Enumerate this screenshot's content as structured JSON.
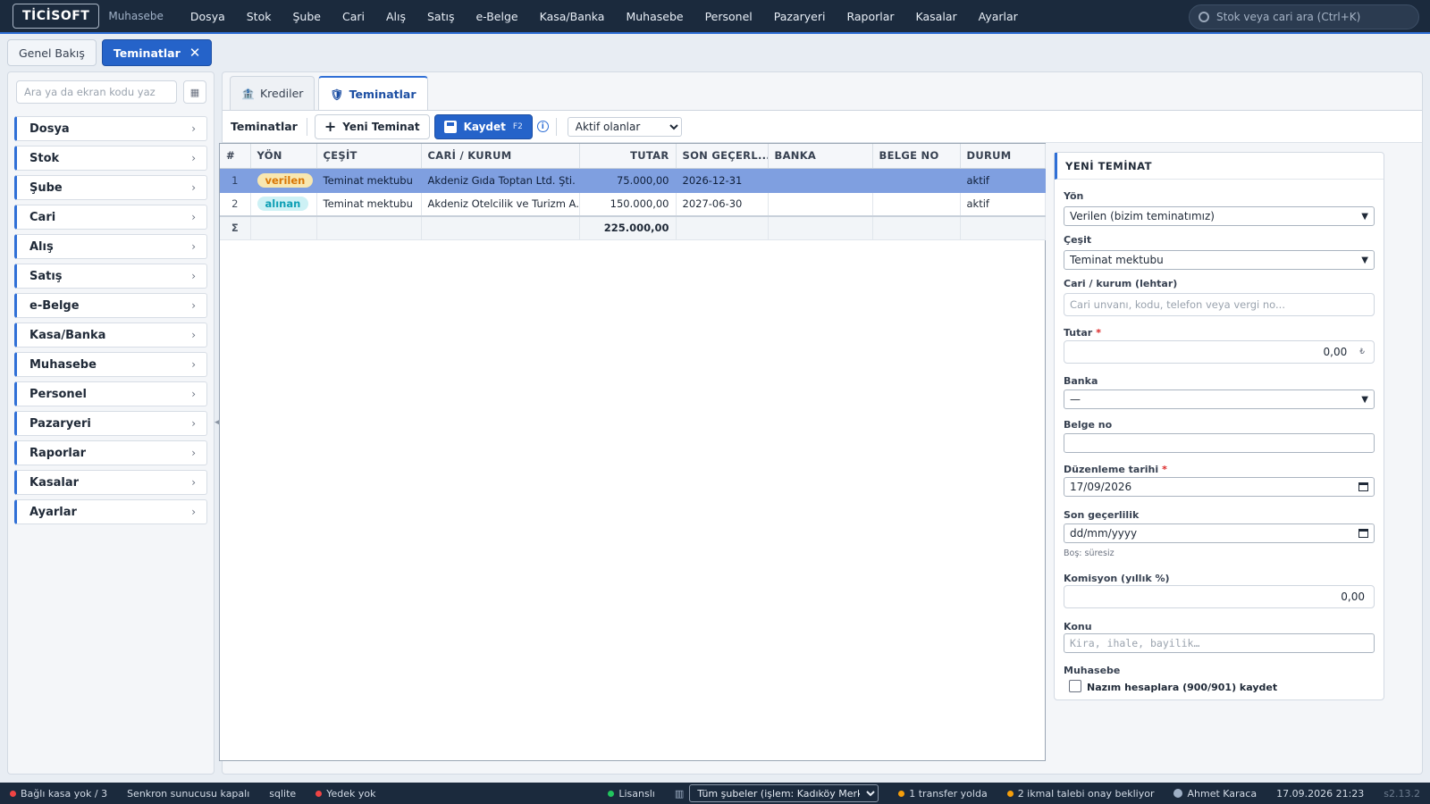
{
  "topbar": {
    "logo": "TİCİSOFT",
    "module": "Muhasebe",
    "menu": [
      "Dosya",
      "Stok",
      "Şube",
      "Cari",
      "Alış",
      "Satış",
      "e-Belge",
      "Kasa/Banka",
      "Muhasebe",
      "Personel",
      "Pazaryeri",
      "Raporlar",
      "Kasalar",
      "Ayarlar"
    ],
    "search_placeholder": "Stok veya cari ara (Ctrl+K)"
  },
  "page_tabs": {
    "overview": "Genel Bakış",
    "active": "Teminatlar",
    "close_glyph": "✕"
  },
  "sidebar": {
    "search_placeholder": "Ara ya da ekran kodu yaz",
    "items": [
      "Dosya",
      "Stok",
      "Şube",
      "Cari",
      "Alış",
      "Satış",
      "e-Belge",
      "Kasa/Banka",
      "Muhasebe",
      "Personel",
      "Pazaryeri",
      "Raporlar",
      "Kasalar",
      "Ayarlar"
    ]
  },
  "subtabs": {
    "krediler": "Krediler",
    "teminatlar": "Teminatlar"
  },
  "toolbar": {
    "title": "Teminatlar",
    "new_label": "Yeni Teminat",
    "save_label": "Kaydet",
    "save_shortcut": "F2",
    "filter_value": "Aktif olanlar",
    "filter_options": [
      "Aktif olanlar"
    ]
  },
  "table": {
    "columns": [
      "#",
      "YÖN",
      "ÇEŞİT",
      "CARİ / KURUM",
      "TUTAR",
      "SON GEÇERL...",
      "BANKA",
      "BELGE NO",
      "DURUM"
    ],
    "rows": [
      {
        "idx": "1",
        "yon": "verilen",
        "cesit": "Teminat mektubu",
        "cari": "Akdeniz Gıda Toptan Ltd. Şti.",
        "tutar": "75.000,00",
        "son": "2026-12-31",
        "banka": "",
        "belge": "",
        "durum": "aktif"
      },
      {
        "idx": "2",
        "yon": "alınan",
        "cesit": "Teminat mektubu",
        "cari": "Akdeniz Otelcilik ve Turizm A.Ş.",
        "tutar": "150.000,00",
        "son": "2027-06-30",
        "banka": "",
        "belge": "",
        "durum": "aktif"
      }
    ],
    "sum_symbol": "Σ",
    "sum_total": "225.000,00"
  },
  "form": {
    "title": "YENİ TEMİNAT",
    "yon_label": "Yön",
    "yon_value": "Verilen (bizim teminatımız)",
    "cesit_label": "Çeşit",
    "cesit_value": "Teminat mektubu",
    "cari_label": "Cari / kurum (lehtar)",
    "cari_placeholder": "Cari unvanı, kodu, telefon veya vergi no...",
    "tutar_label": "Tutar",
    "tutar_value": "0,00",
    "currency": "₺",
    "banka_label": "Banka",
    "banka_value": "—",
    "belge_label": "Belge no",
    "belge_value": "",
    "duzenleme_label": "Düzenleme tarihi",
    "duzenleme_value": "17/09/2026",
    "son_label": "Son geçerlilik",
    "son_placeholder": "dd/mm/yyyy",
    "son_hint": "Boş: süresiz",
    "komisyon_label": "Komisyon (yıllık %)",
    "komisyon_value": "0,00",
    "konu_label": "Konu",
    "konu_placeholder": "Kira, ihale, bayilik…",
    "muhasebe_label": "Muhasebe",
    "nazim_label": "Nazım hesaplara (900/901) kaydet",
    "required_mark": "*"
  },
  "statusbar": {
    "kasa": "Bağlı kasa yok / 3",
    "senkron": "Senkron sunucusu kapalı",
    "db": "sqlite",
    "yedek": "Yedek yok",
    "lisans": "Lisanslı",
    "sube_select": "Tüm şubeler (işlem: Kadıköy Merkez)",
    "transfer": "1 transfer yolda",
    "ikmal": "2 ikmal talebi onay bekliyor",
    "user": "Ahmet Karaca",
    "datetime": "17.09.2026 21:23",
    "version": "s2.13.2"
  },
  "colors": {
    "accent": "#2563c9",
    "topbar": "#1b2a3d",
    "selected_row": "#7f9fe0",
    "status_green": "#22c55e",
    "status_red": "#ef4444",
    "status_orange": "#f59e0b"
  }
}
